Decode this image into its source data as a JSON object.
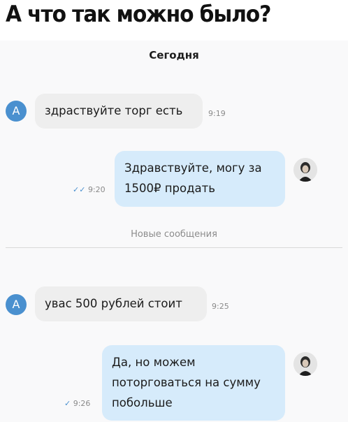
{
  "caption": "А что так можно было?",
  "chat": {
    "date_label": "Сегодня",
    "new_messages_label": "Новые сообщения",
    "messages": [
      {
        "avatar": "А",
        "lines": [
          "здраствуйте торг есть"
        ],
        "time": "9:19"
      },
      {
        "lines": [
          "Здравствуйте, могу за",
          "1500₽ продать"
        ],
        "time": "9:20",
        "status": "✓✓"
      },
      {
        "avatar": "А",
        "lines": [
          "увас 500 рублей стоит"
        ],
        "time": "9:25"
      },
      {
        "lines": [
          "Да, но можем",
          "поторговаться на сумму",
          "побольше"
        ],
        "time": "9:26",
        "status": "✓"
      }
    ]
  },
  "colors": {
    "accent": "#4a90cf",
    "incoming_bubble": "#eeeeee",
    "outgoing_bubble": "#d6ebfb"
  }
}
